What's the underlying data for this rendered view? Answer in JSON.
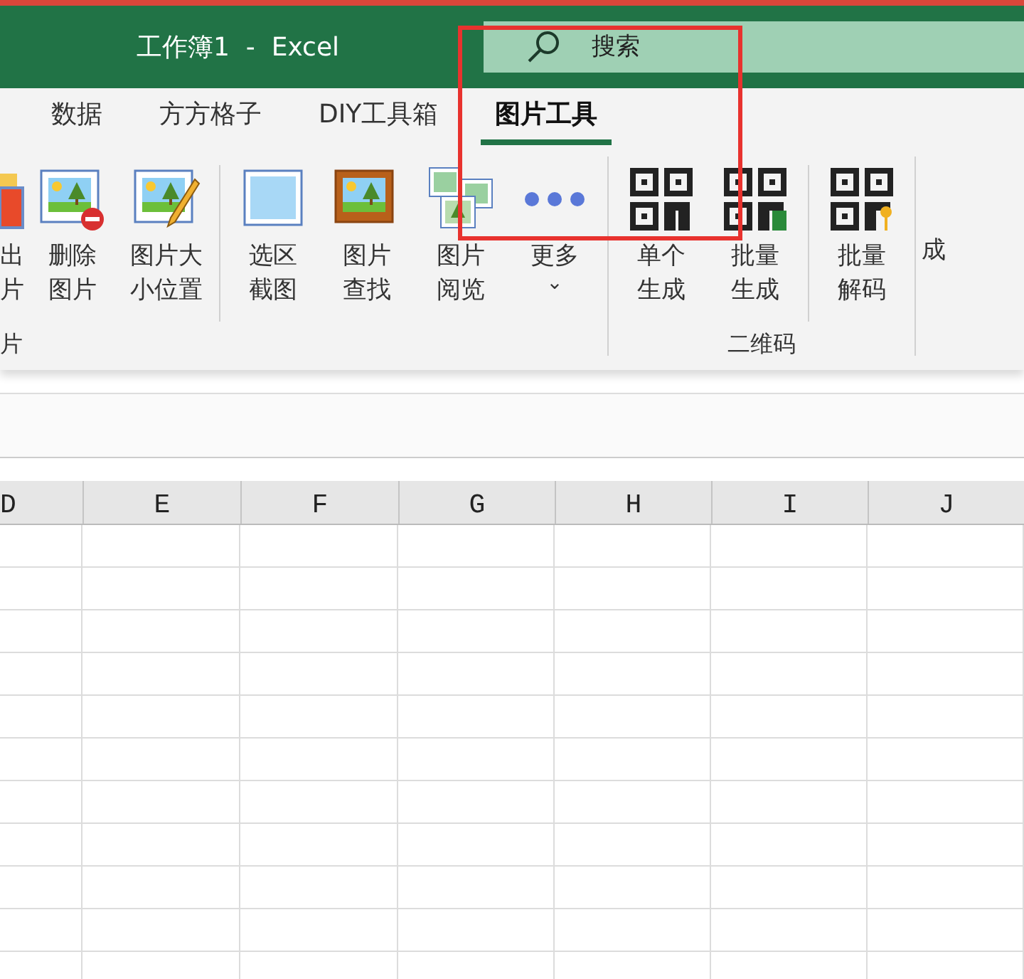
{
  "window": {
    "title": "工作簿1  -  Excel"
  },
  "search": {
    "placeholder": "搜索"
  },
  "tabs": [
    {
      "label": "数据",
      "selected": false
    },
    {
      "label": "方方格子",
      "selected": false
    },
    {
      "label": "DIY工具箱",
      "selected": false
    },
    {
      "label": "图片工具",
      "selected": true
    }
  ],
  "ribbon": {
    "groups": [
      {
        "label": "片",
        "buttons": [
          {
            "kind": "export",
            "label": "出片"
          },
          {
            "kind": "delete",
            "label": "删除图片"
          },
          {
            "kind": "resize",
            "label": "图片大小位置"
          },
          {
            "kind": "sep"
          },
          {
            "kind": "select",
            "label": "选区截图"
          },
          {
            "kind": "find",
            "label": "图片查找"
          },
          {
            "kind": "browse",
            "label": "图片阅览"
          },
          {
            "kind": "more",
            "label": "更多",
            "caret": "⌄"
          }
        ]
      },
      {
        "label": "二维码",
        "buttons": [
          {
            "kind": "qrsingle",
            "label": "单个生成"
          },
          {
            "kind": "qrbatch",
            "label": "批量生成"
          },
          {
            "kind": "sep"
          },
          {
            "kind": "qrdecode",
            "label": "批量解码"
          }
        ]
      },
      {
        "buttons": [
          {
            "kind": "cut",
            "label": "成"
          }
        ]
      }
    ]
  },
  "sheet": {
    "columns": [
      "D",
      "E",
      "F",
      "G",
      "H",
      "I",
      "J"
    ]
  }
}
